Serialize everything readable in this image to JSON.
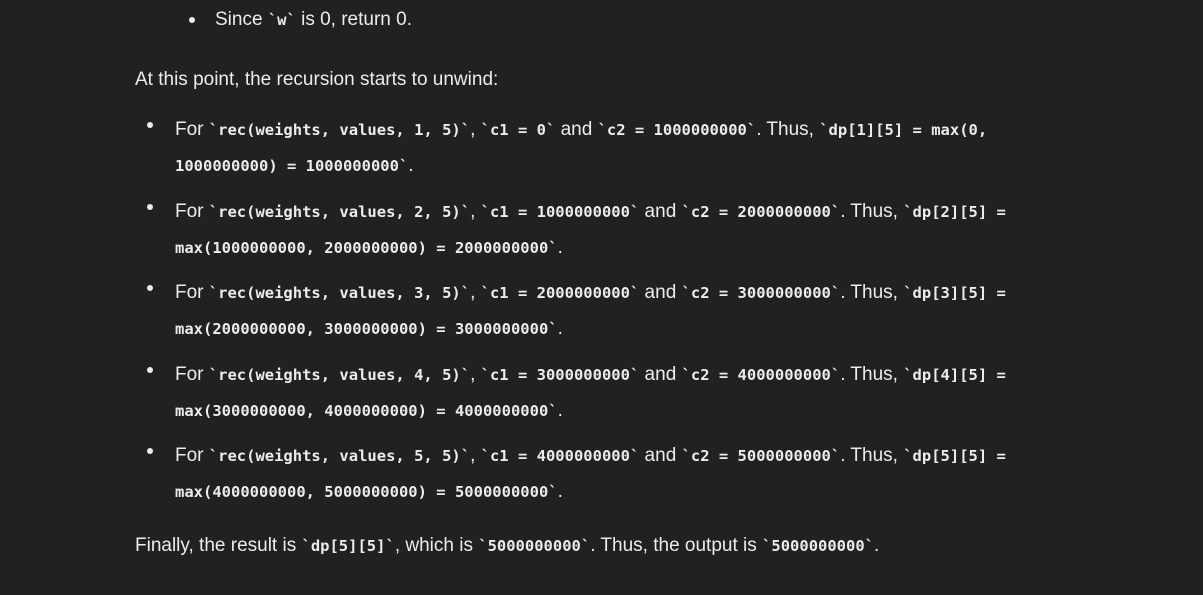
{
  "top_item": {
    "prefix": "Since ",
    "code": "`w`",
    "suffix": " is 0, return 0."
  },
  "unwind_text": "At this point, the recursion starts to unwind:",
  "items": [
    {
      "p1": "For ",
      "c1": "`rec(weights, values, 1, 5)`",
      "p2": ", ",
      "c2": "`c1 = 0`",
      "p3": " and ",
      "c3": "`c2 = 1000000000`",
      "p4": ". Thus, ",
      "c4": "`dp[1][5] = max(0, 1000000000) = 1000000000`",
      "p5": "."
    },
    {
      "p1": "For ",
      "c1": "`rec(weights, values, 2, 5)`",
      "p2": ", ",
      "c2": "`c1 = 1000000000`",
      "p3": " and ",
      "c3": "`c2 = 2000000000`",
      "p4": ". Thus, ",
      "c4": "`dp[2][5] = max(1000000000, 2000000000) = 2000000000`",
      "p5": "."
    },
    {
      "p1": "For ",
      "c1": "`rec(weights, values, 3, 5)`",
      "p2": ", ",
      "c2": "`c1 = 2000000000`",
      "p3": " and ",
      "c3": "`c2 = 3000000000`",
      "p4": ". Thus, ",
      "c4": "`dp[3][5] = max(2000000000, 3000000000) = 3000000000`",
      "p5": "."
    },
    {
      "p1": "For ",
      "c1": "`rec(weights, values, 4, 5)`",
      "p2": ", ",
      "c2": "`c1 = 3000000000`",
      "p3": " and ",
      "c3": "`c2 = 4000000000`",
      "p4": ". Thus, ",
      "c4": "`dp[4][5] = max(3000000000, 4000000000) = 4000000000`",
      "p5": "."
    },
    {
      "p1": "For ",
      "c1": "`rec(weights, values, 5, 5)`",
      "p2": ", ",
      "c2": "`c1 = 4000000000`",
      "p3": " and ",
      "c3": "`c2 = 5000000000`",
      "p4": ". Thus, ",
      "c4": "`dp[5][5] = max(4000000000, 5000000000) = 5000000000`",
      "p5": "."
    }
  ],
  "final": {
    "p1": "Finally, the result is ",
    "c1": "`dp[5][5]`",
    "p2": ", which is ",
    "c2": "`5000000000`",
    "p3": ". Thus, the output is ",
    "c3": "`5000000000`",
    "p4": "."
  }
}
